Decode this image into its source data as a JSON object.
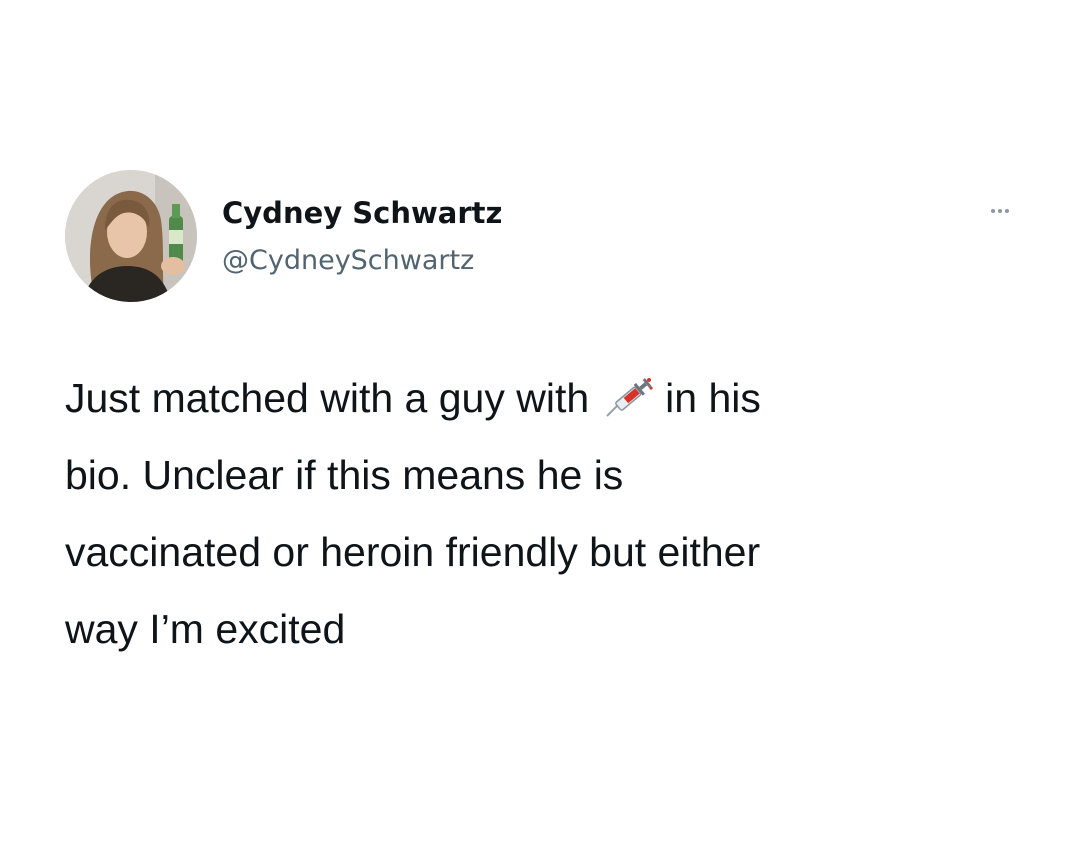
{
  "tweet": {
    "author": {
      "display_name": "Cydney Schwartz",
      "handle": "@CydneySchwartz"
    },
    "more_icon": "more-horizontal-icon",
    "text": {
      "line1_before_emoji": "Just matched with a guy with",
      "emoji": "syringe-emoji",
      "line1_after_emoji": "in his",
      "line2": "bio. Unclear if this means he is",
      "line3": "vaccinated or heroin friendly but either",
      "line4": "way I’m excited"
    }
  }
}
